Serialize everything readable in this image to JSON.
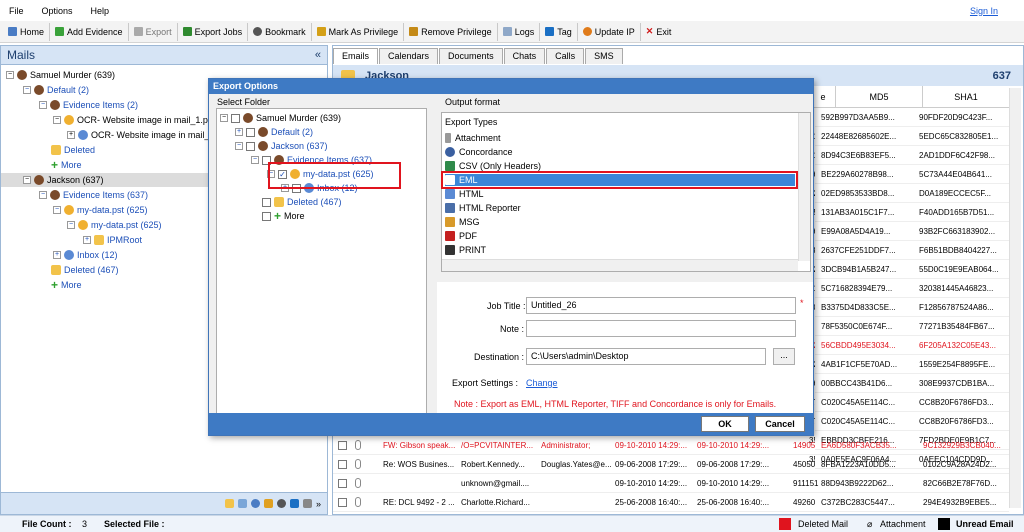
{
  "menu": {
    "file": "File",
    "options": "Options",
    "help": "Help",
    "signin": "Sign In"
  },
  "toolbar": {
    "home": "Home",
    "add_evidence": "Add Evidence",
    "export": "Export",
    "export_jobs": "Export Jobs",
    "bookmark": "Bookmark",
    "mark_privilege": "Mark As Privilege",
    "remove_privilege": "Remove Privilege",
    "logs": "Logs",
    "tag": "Tag",
    "update_ip": "Update IP",
    "exit": "Exit"
  },
  "left": {
    "title": "Mails",
    "collapse": "«",
    "tree": [
      {
        "label": "Samuel Murder (639)"
      },
      {
        "label": "Default (2)"
      },
      {
        "label": "Evidence Items (2)"
      },
      {
        "label": "OCR- Website image in mail_1.ps"
      },
      {
        "label": "OCR- Website image in mail_1.pst"
      },
      {
        "label": "Deleted"
      },
      {
        "label": "More"
      },
      {
        "label": "Jackson (637)"
      },
      {
        "label": "Evidence Items (637)"
      },
      {
        "label": "my-data.pst (625)"
      },
      {
        "label": "my-data.pst (625)"
      },
      {
        "label": "IPMRoot"
      },
      {
        "label": "Inbox (12)"
      },
      {
        "label": "Deleted (467)"
      },
      {
        "label": "More"
      }
    ]
  },
  "right": {
    "tabs": [
      "Emails",
      "Calendars",
      "Documents",
      "Chats",
      "Calls",
      "SMS"
    ],
    "header": "Jackson",
    "count": "637",
    "col_partial": "e",
    "col_md5": "MD5",
    "col_sha1": "SHA1",
    "hash_rows": [
      {
        "c0": "2",
        "md5": "592B997D3AA5B9...",
        "sha1": "90FDF20D9C423F...",
        "red": false
      },
      {
        "c0": "91",
        "md5": "22448E82685602E...",
        "sha1": "5EDC65C832805E1...",
        "red": false
      },
      {
        "c0": "91",
        "md5": "8D94C3E6B83EF5...",
        "sha1": "2AD1DDF6C42F98...",
        "red": false
      },
      {
        "c0": "36",
        "md5": "BE229A60278B98...",
        "sha1": "5C73A44E04B641...",
        "red": false
      },
      {
        "c0": "32",
        "md5": "02ED9853533BD8...",
        "sha1": "D0A189ECCEC5F...",
        "red": false
      },
      {
        "c0": "35",
        "md5": "131AB3A015C1F7...",
        "sha1": "F40ADD165B7D51...",
        "red": false
      },
      {
        "c0": "36",
        "md5": "E99A08A5D4A19...",
        "sha1": "93B2FC663183902...",
        "red": false
      },
      {
        "c0": "78",
        "md5": "2637CFE251DDF7...",
        "sha1": "F6B51BDB8404227...",
        "red": false
      },
      {
        "c0": "32",
        "md5": "3DCB94B1A5B247...",
        "sha1": "55D0C19E9EAB064...",
        "red": false
      },
      {
        "c0": "31",
        "md5": "5C716828394E79...",
        "sha1": "320381445A46823...",
        "red": false
      },
      {
        "c0": "20",
        "md5": "B3375D4D833C5E...",
        "sha1": "F12856787524A86...",
        "red": false
      },
      {
        "c0": "",
        "md5": "78F5350C0E674F...",
        "sha1": "77271B35484FB67...",
        "red": false
      },
      {
        "c0": "32",
        "md5": "56CBDD495E3034...",
        "sha1": "6F205A132C05E43...",
        "red": true
      },
      {
        "c0": "32",
        "md5": "4AB1F1CF5E70AD...",
        "sha1": "1559E254F8895FE...",
        "red": false
      },
      {
        "c0": "36",
        "md5": "00BBCC43B41D6...",
        "sha1": "308E9937CDB1BA...",
        "red": false
      },
      {
        "c0": "37",
        "md5": "C020C45A5E114C...",
        "sha1": "CC8B20F6786FD3...",
        "red": false
      },
      {
        "c0": "37",
        "md5": "C020C45A5E114C...",
        "sha1": "CC8B20F6786FD3...",
        "red": false
      },
      {
        "c0": "35",
        "md5": "EBBDD3CBFE216...",
        "sha1": "7FD2BDE0E9B1C7...",
        "red": false
      },
      {
        "c0": "35",
        "md5": "0A0E5EAC9F06A4...",
        "sha1": "0AEEC104CDD9D...",
        "red": false
      }
    ],
    "email_rows": [
      {
        "subject": "FW: Gibson speak...",
        "from": "/O=PCVITAINTER...",
        "to": "Administrator;",
        "sent": "09-10-2010 14:29:...",
        "recv": "09-10-2010 14:29:...",
        "size": "14905",
        "md5": "EA6D580F3ACB35...",
        "sha1": "9C132929B3CB040...",
        "red": true,
        "attach": true
      },
      {
        "subject": "Re: WOS Busines...",
        "from": "Robert.Kennedy...",
        "to": "Douglas.Yates@e...",
        "sent": "09-06-2008 17:29:...",
        "recv": "09-06-2008 17:29:...",
        "size": "45050",
        "md5": "8FBA1223A10DD5...",
        "sha1": "0102C9A28A24D2...",
        "red": false,
        "attach": true
      },
      {
        "subject": "",
        "from": "unknown@gmail....",
        "to": "",
        "sent": "09-10-2010 14:29:...",
        "recv": "09-10-2010 14:29:...",
        "size": "911151",
        "md5": "88D943B9222D62...",
        "sha1": "82C66B2E78F76D...",
        "red": false,
        "attach": true
      },
      {
        "subject": "RE: DCL 9492 - 2 ...",
        "from": "Charlotte.Richard...",
        "to": "",
        "sent": "25-06-2008 16:40:...",
        "recv": "25-06-2008 16:40:...",
        "size": "49260",
        "md5": "C372BC283C5447...",
        "sha1": "294E4932B9EBE5...",
        "red": false,
        "attach": true
      }
    ]
  },
  "dialog": {
    "title": "Export Options",
    "select_folder": "Select Folder",
    "output_format": "Output format",
    "folder_tree": [
      {
        "label": "Samuel Murder (639)"
      },
      {
        "label": "Default (2)"
      },
      {
        "label": "Jackson (637)"
      },
      {
        "label": "Evidence Items (637)"
      },
      {
        "label": "my-data.pst (625)"
      },
      {
        "label": "Inbox (12)"
      },
      {
        "label": "Deleted (467)"
      },
      {
        "label": "More"
      }
    ],
    "export_types_label": "Export Types",
    "formats": [
      "Attachment",
      "Concordance",
      "CSV (Only Headers)",
      "EML",
      "HTML",
      "HTML Reporter",
      "MSG",
      "PDF",
      "PRINT"
    ],
    "selected_format": "EML",
    "job_title_label": "Job Title :",
    "job_title": "Untitled_26",
    "required_mark": "*",
    "note_label": "Note :",
    "note": "",
    "destination_label": "Destination :",
    "destination": "C:\\Users\\admin\\Desktop",
    "browse": "...",
    "export_settings_label": "Export Settings :",
    "change": "Change",
    "note_text": "Note : Export as EML, HTML Reporter, TIFF and Concordance is only for Emails.",
    "ok": "OK",
    "cancel": "Cancel"
  },
  "status": {
    "file_count_label": "File Count :",
    "file_count": "3",
    "selected_file_label": "Selected File :",
    "deleted_mail": "Deleted Mail",
    "attachment": "Attachment",
    "unread_email": "Unread Email"
  },
  "colors": {
    "accent": "#3e7ac4",
    "highlight": "#e0141e",
    "select": "#3a86d8"
  }
}
